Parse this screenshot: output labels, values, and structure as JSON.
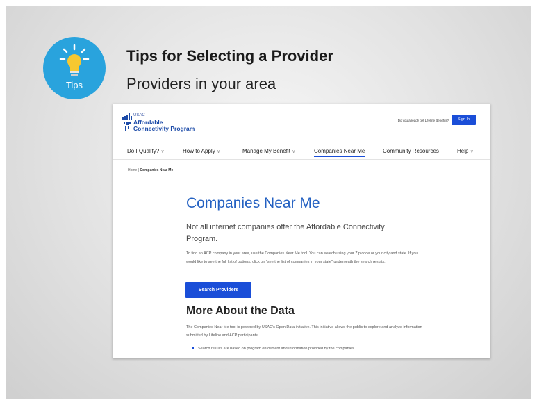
{
  "slide": {
    "badge_label": "Tips",
    "title": "Tips for Selecting a Provider",
    "subtitle": "Providers in your area"
  },
  "website": {
    "logo": {
      "line1": "USAC",
      "line2": "Affordable",
      "line3": "Connectivity Program"
    },
    "already_text": "Do you already get Lifeline Benefits?",
    "sign_in": "Sign In",
    "nav": [
      {
        "label": "Do I Qualify?",
        "chevron": true
      },
      {
        "label": "How to Apply",
        "chevron": true
      },
      {
        "label": "Manage My Benefit",
        "chevron": true
      },
      {
        "label": "Companies Near Me",
        "chevron": false,
        "active": true
      },
      {
        "label": "Community Resources",
        "chevron": false
      },
      {
        "label": "Help",
        "chevron": true
      }
    ],
    "breadcrumb": {
      "home": "Home",
      "separator": "|",
      "current": "Companies Near Me"
    },
    "heading": "Companies Near Me",
    "lead": "Not all internet companies offer the Affordable Connectivity Program.",
    "body1": "To find an ACP company in your area, use the Companies Near Me tool. You can search using your Zip code or your city and state. If you would like to see the full list of options, click on \"see the list of companies in your state\" underneath the search results.",
    "search_button": "Search Providers",
    "subheading": "More About the Data",
    "body2": "The Companies Near Me tool is powered by USAC's Open Data initiative. This initiative allows the public to explore and analyze information submitted by Lifeline and ACP participants.",
    "bullet1": "Search results are based on program enrollment and information provided by the companies."
  },
  "colors": {
    "badge": "#29a3dd",
    "brand_blue": "#1a4ed8",
    "heading_blue": "#2461c2"
  }
}
